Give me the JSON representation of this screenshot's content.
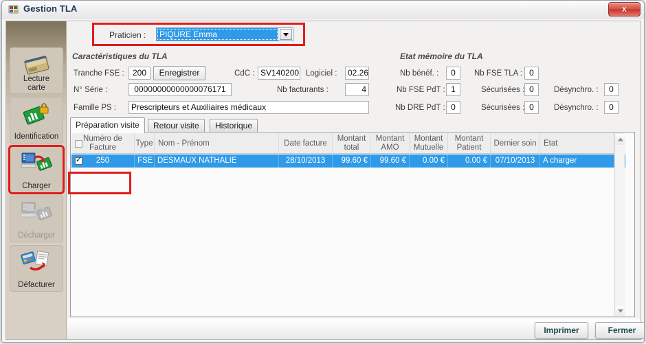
{
  "window": {
    "title": "Gestion TLA",
    "icon": "app-window-icon",
    "close_label": "x"
  },
  "praticien": {
    "label": "Praticien :",
    "selected": "PIQURE Emma",
    "highlight_color": "#e01b1b"
  },
  "caracteristiques": {
    "caption": "Caractéristiques du TLA",
    "tranche_fse_label": "Tranche FSE :",
    "tranche_fse_value": "200",
    "enregistrer_label": "Enregistrer",
    "cdc_label": "CdC :",
    "cdc_value": "SV140200",
    "logiciel_label": "Logiciel :",
    "logiciel_value": "02.26",
    "serie_label": "N° Série :",
    "serie_value": "00000000000000076171",
    "facturants_label": "Nb facturants :",
    "facturants_value": "4",
    "famille_label": "Famille PS :",
    "famille_value": "Prescripteurs et Auxiliaires médicaux"
  },
  "etat_memoire": {
    "caption": "Etat mémoire du TLA",
    "nb_benef_label": "Nb bénéf. :",
    "nb_benef_value": "0",
    "nb_fse_tla_label": "Nb FSE TLA :",
    "nb_fse_tla_value": "0",
    "nb_fse_pdt_label": "Nb FSE PdT :",
    "nb_fse_pdt_value": "1",
    "securisees1_label": "Sécurisées :",
    "securisees1_value": "0",
    "desynchro1_label": "Désynchro. :",
    "desynchro1_value": "0",
    "nb_dre_pdt_label": "Nb DRE PdT :",
    "nb_dre_pdt_value": "0",
    "securisees2_label": "Sécurisées :",
    "securisees2_value": "0",
    "desynchro2_label": "Désynchro. :",
    "desynchro2_value": "0"
  },
  "sidebar": {
    "items": [
      {
        "label_line1": "Lecture",
        "label_line2": "carte",
        "icon": "card-reader-icon",
        "state": "enabled",
        "highlighted": false
      },
      {
        "label_line1": "Identification",
        "label_line2": "",
        "icon": "card-lock-icon",
        "state": "enabled",
        "highlighted": false
      },
      {
        "label_line1": "Charger",
        "label_line2": "",
        "icon": "pc-to-device-icon",
        "state": "enabled",
        "highlighted": true
      },
      {
        "label_line1": "Décharger",
        "label_line2": "",
        "icon": "device-to-pc-icon",
        "state": "disabled",
        "highlighted": false
      },
      {
        "label_line1": "Défacturer",
        "label_line2": "",
        "icon": "invoice-undo-icon",
        "state": "enabled",
        "highlighted": false
      }
    ]
  },
  "tabs": [
    {
      "label": "Préparation visite",
      "active": true
    },
    {
      "label": "Retour visite",
      "active": false
    },
    {
      "label": "Historique",
      "active": false
    }
  ],
  "grid": {
    "columns": [
      "Numéro de Facture",
      "Type",
      "Nom - Prénom",
      "Date facture",
      "Montant total",
      "Montant AMO",
      "Montant Mutuelle",
      "Montant Patient",
      "Dernier soin",
      "Etat"
    ],
    "rows": [
      {
        "checked": true,
        "numero": "250",
        "type": "FSE",
        "nom": "DESMAUX NATHALIE",
        "date_facture": "28/10/2013",
        "montant_total": "99.60 €",
        "montant_amo": "99.60 €",
        "montant_mutuelle": "0.00 €",
        "montant_patient": "0.00 €",
        "dernier_soin": "07/10/2013",
        "etat": "A charger",
        "selected": true
      }
    ],
    "selection_color": "#2f9ae8"
  },
  "footer": {
    "imprimer_label": "Imprimer",
    "fermer_label": "Fermer"
  }
}
